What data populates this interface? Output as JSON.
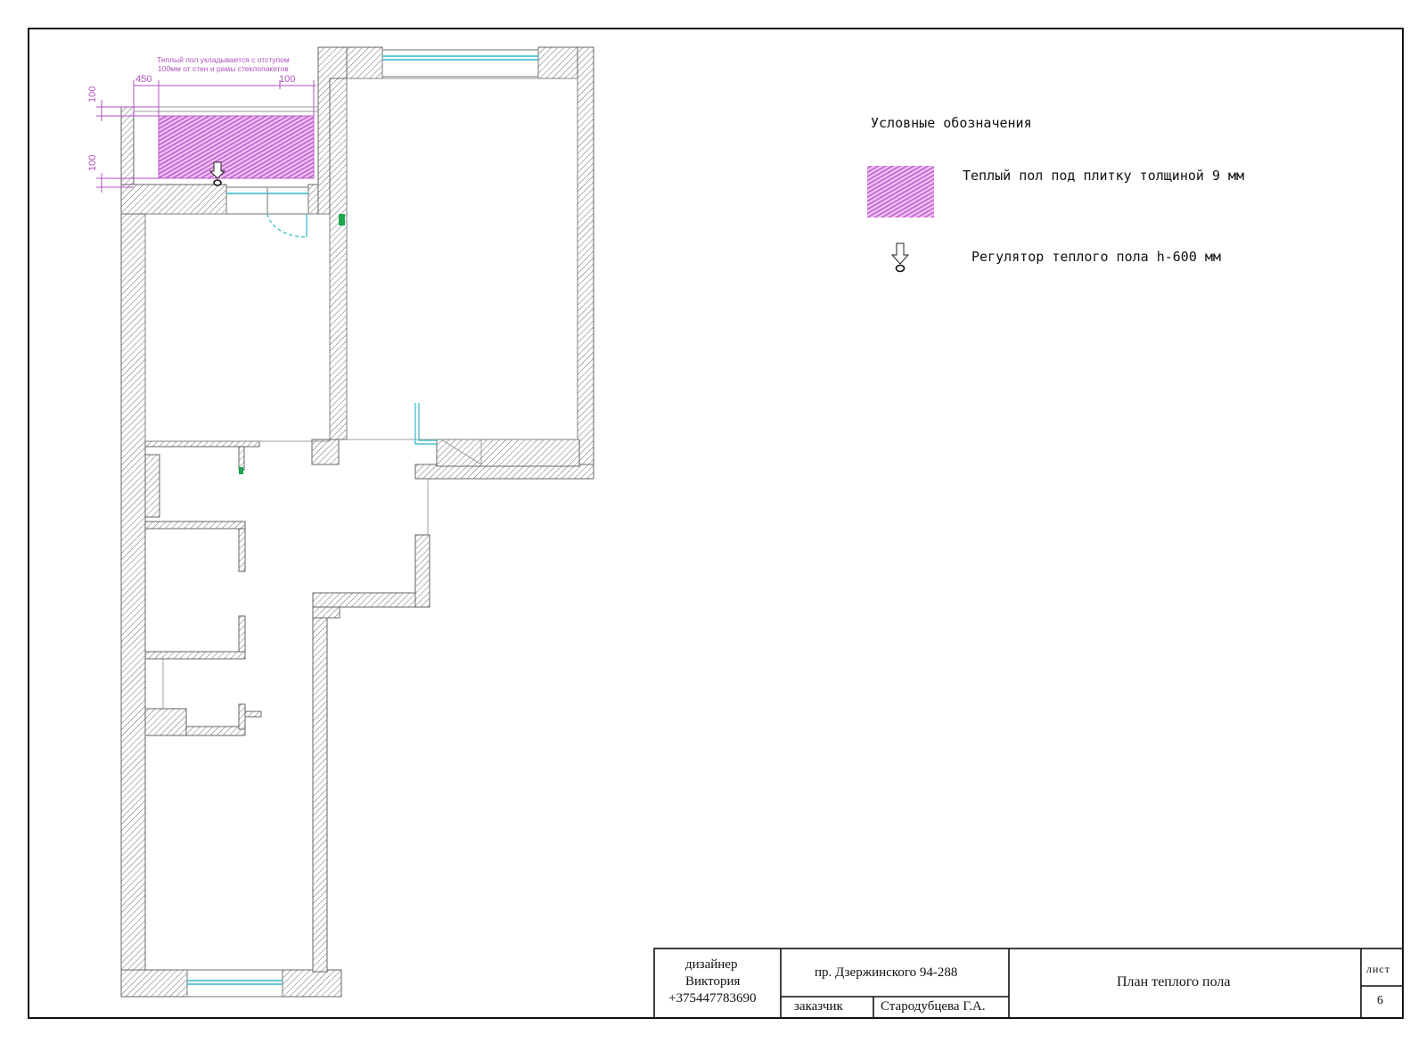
{
  "plan": {
    "note_line1": "Теплый пол укладывается с отступом",
    "note_line2": "100мм от стен и рамы стеклопакетов",
    "dim_450": "450",
    "dim_100_top": "100",
    "dim_100_v1": "100",
    "dim_100_v2": "100"
  },
  "legend": {
    "title": "Условные обозначения",
    "items": [
      {
        "label": "Теплый пол под плитку толщиной 9 мм",
        "icon": "floor-heating-hatch-icon"
      },
      {
        "label": "Регулятор теплого пола h-600 мм",
        "icon": "thermostat-arrow-icon"
      }
    ]
  },
  "title_block": {
    "designer_role": "дизайнер",
    "designer_name": "Виктория",
    "designer_phone": "+375447783690",
    "address": "пр. Дзержинского 94-288",
    "client_label": "заказчик",
    "client_name": "Стародубцева Г.А.",
    "sheet_title": "План теплого пола",
    "sheet_label": "лист",
    "sheet_number": "6"
  },
  "colors": {
    "wall_hatch": "#555555",
    "floor_heating": "#c05ad0",
    "window": "#31b8c8",
    "door": "#31b8c8",
    "marker": "#19a84a",
    "dimension": "#b04fc0"
  }
}
